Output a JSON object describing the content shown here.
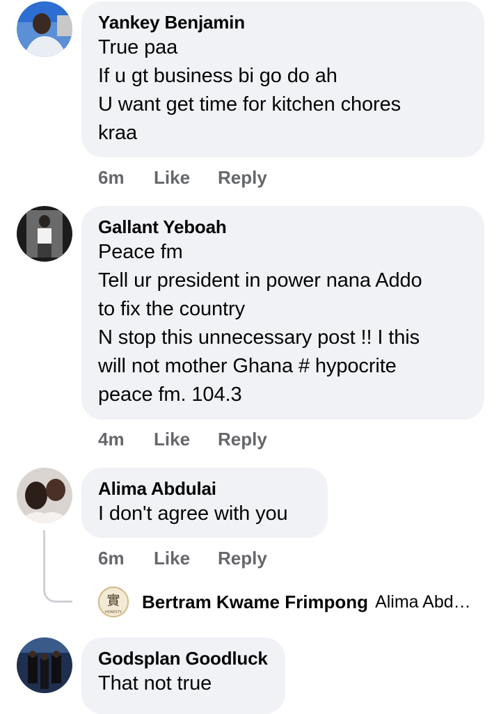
{
  "comments": [
    {
      "author": "Yankey Benjamin",
      "lines": [
        "True paa",
        "If u gt business bi go do ah",
        "U want get time for kitchen chores",
        "kraa"
      ],
      "time": "6m",
      "like": "Like",
      "reply": "Reply"
    },
    {
      "author": "Gallant Yeboah",
      "lines": [
        "Peace fm",
        "Tell ur president in power nana Addo",
        "to fix the country",
        "N stop this unnecessary post !! I this",
        "will not mother Ghana # hypocrite",
        "peace fm. 104.3"
      ],
      "time": "4m",
      "like": "Like",
      "reply": "Reply"
    },
    {
      "author": "Alima Abdulai",
      "lines": [
        "I don't agree with you"
      ],
      "time": "6m",
      "like": "Like",
      "reply": "Reply"
    },
    {
      "author": "Godsplan Goodluck",
      "lines": [
        "That not true"
      ]
    }
  ],
  "reply_preview": {
    "author": "Bertram Kwame Frimpong",
    "snippet": "Alima Abd…",
    "avatar_text": "HONESTY",
    "avatar_glyph": "實"
  }
}
